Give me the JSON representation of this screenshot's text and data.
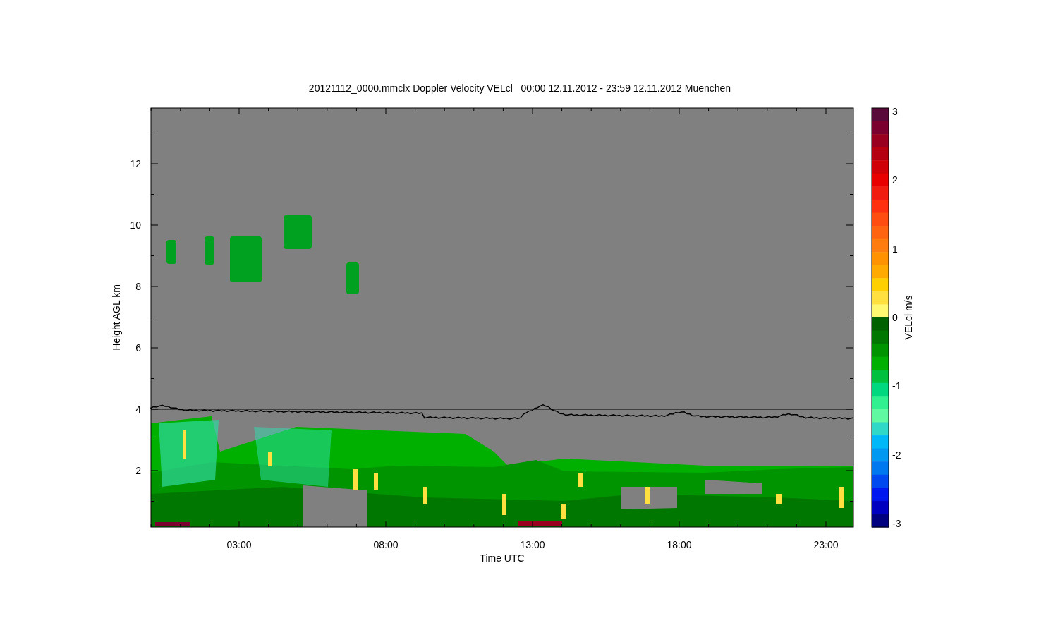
{
  "chart": {
    "title": "20121112_0000.mmclx Doppler Velocity VELcl   00:00 12.11.2012 - 23:59 12.11.2012 Muenchen",
    "xlabel": "Time UTC",
    "ylabel": "Height AGL km",
    "xtick_labels": [
      "03:00",
      "08:00",
      "13:00",
      "18:00",
      "23:00"
    ],
    "ytick_labels": [
      "12",
      "10",
      "8",
      "6",
      "4",
      "2"
    ]
  },
  "colorbar": {
    "label": "VELcl m/s",
    "tick_labels": [
      "3",
      "2",
      "1",
      "0",
      "-1",
      "-2",
      "-3"
    ],
    "segments": [
      {
        "color": "#5a0a3a"
      },
      {
        "color": "#7a0030"
      },
      {
        "color": "#990020"
      },
      {
        "color": "#b40010"
      },
      {
        "color": "#d00008"
      },
      {
        "color": "#e80000"
      },
      {
        "color": "#f01c10"
      },
      {
        "color": "#ff3010"
      },
      {
        "color": "#ff4c10"
      },
      {
        "color": "#ff6410"
      },
      {
        "color": "#ff7c10"
      },
      {
        "color": "#ff9200"
      },
      {
        "color": "#ffaa00"
      },
      {
        "color": "#ffd000"
      },
      {
        "color": "#ffe040"
      },
      {
        "color": "#fff870"
      },
      {
        "color": "#006000"
      },
      {
        "color": "#007800"
      },
      {
        "color": "#009400"
      },
      {
        "color": "#00b000"
      },
      {
        "color": "#00c040"
      },
      {
        "color": "#00d880"
      },
      {
        "color": "#30f090"
      },
      {
        "color": "#60f8a0"
      },
      {
        "color": "#30d8c8"
      },
      {
        "color": "#00b8f8"
      },
      {
        "color": "#0098f0"
      },
      {
        "color": "#0078f0"
      },
      {
        "color": "#0048f0"
      },
      {
        "color": "#0018f0"
      },
      {
        "color": "#0000c0"
      },
      {
        "color": "#000080"
      }
    ]
  }
}
